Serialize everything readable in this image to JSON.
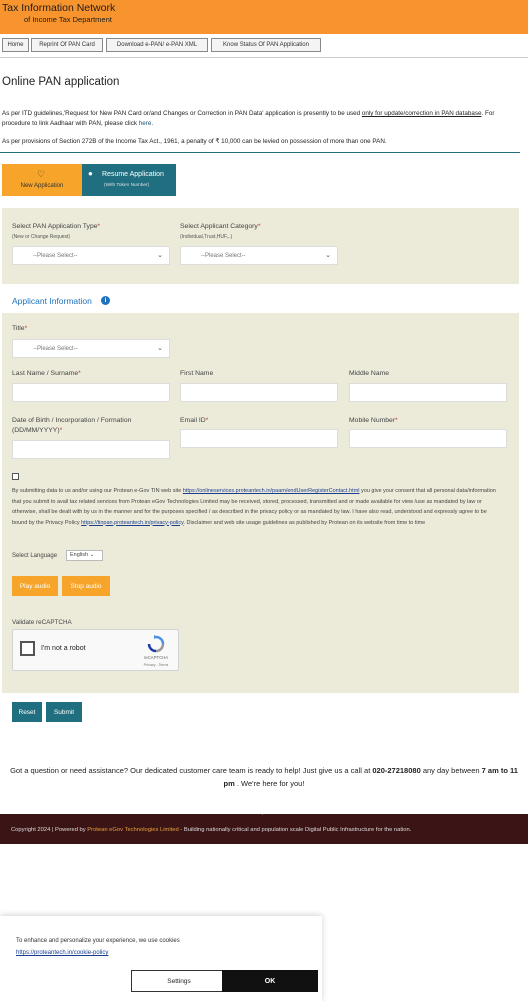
{
  "header": {
    "title": "Tax Information Network",
    "subtitle": "of Income Tax Department",
    "bg_color": "#f7942d"
  },
  "topnav": {
    "items": [
      {
        "label": "Home"
      },
      {
        "label": "Reprint Of PAN Card"
      },
      {
        "label": "Download e-PAN/ e-PAN XML"
      },
      {
        "label": "Know Status Of PAN Application"
      }
    ]
  },
  "page": {
    "title": "Online PAN application",
    "para1_pre": "As per ITD guidelines,'Request for New PAN Card or/and Changes or Correction in PAN Data' application is presently to be used ",
    "para1_underline": "only for update/correction in PAN database",
    "para1_mid": ". For procedure to link Aadhaar with PAN, please click ",
    "para1_link": "here",
    "para1_end": ".",
    "para2": "As per provisions of Section 272B of the Income Tax Act., 1961, a penalty of ₹ 10,000 can be levied on possession of more than one PAN."
  },
  "tabs": {
    "new_label": "New Application",
    "resume_label": "Resume Application",
    "resume_sub": "(With Token Number)",
    "accent": "#f6a42a",
    "teal": "#1f6f80"
  },
  "form": {
    "app_type_label": "Select PAN Application Type",
    "app_type_hint": "(New or Change Request)",
    "app_type_value": "--Please Select--",
    "category_label": "Select Applicant Category",
    "category_hint": "(Individual,Trust,HUF,..)",
    "category_value": "--Please Select--",
    "applicant_info_heading": "Applicant Information",
    "title_label": "Title",
    "title_value": "--Please Select--",
    "last_name_label": "Last Name / Surname",
    "first_name_label": "First Name",
    "middle_name_label": "Middle Name",
    "dob_label": "Date of Birth / Incorporation / Formation",
    "dob_hint": "(DD/MM/YYYY)",
    "email_label": "Email ID",
    "mobile_label": "Mobile Number",
    "req": "*"
  },
  "consent": {
    "text_a": "By submitting data to us and/or using our Protean e-Gov TIN web site ",
    "link_a": "https://onlineservices.proteantech.in/paam/endUserRegisterContact.html",
    "text_b": " you give your consent that all personal data/information that you submit to avail tax related services from Protean eGov Technologies Limited may be received, stored, processed, transmitted and or made available for view /use as mandated by law or otherwise, shall be dealt with by us in the manner and for the purposes specified / as described in the privacy policy or as mandated by law. I have also read, understood and expressly agree to be bound by the Privacy Policy ",
    "link_b": "https://tinpan.proteantech.in/privacy-policy",
    "text_c": ". Disclaimer and web site usage guidelines as published by Protean on its website from time to time"
  },
  "language": {
    "label": "Select Language",
    "value": "English"
  },
  "audio": {
    "play": "Play audio",
    "stop": "Stop audio"
  },
  "captcha": {
    "label": "Validate reCAPTCHA",
    "checkbox_text": "I'm not a robot",
    "brand": "reCAPTCHA",
    "privacy": "Privacy - Terms"
  },
  "actions": {
    "reset": "Reset",
    "submit": "Submit"
  },
  "help": {
    "pre": "Got a question or need assistance? Our dedicated customer care team is ready to help! Just give us a call at ",
    "phone": "020-27218080",
    "mid": " any day between ",
    "hours": "7 am to 11 pm",
    "end": " . We're here for you!"
  },
  "footer": {
    "pre": "Copyright 2024 | Powered by ",
    "brand": "Protean eGov Technologies Limited",
    "post": " - Building nationally critical and population scale Digital Public Infrastructure for the nation.",
    "bg": "#3b1416"
  },
  "cookie": {
    "text": "To enhance and personalize your experience, we use cookies",
    "link": "https://proteantech.in/cookie-policy",
    "settings": "Settings",
    "ok": "OK"
  }
}
